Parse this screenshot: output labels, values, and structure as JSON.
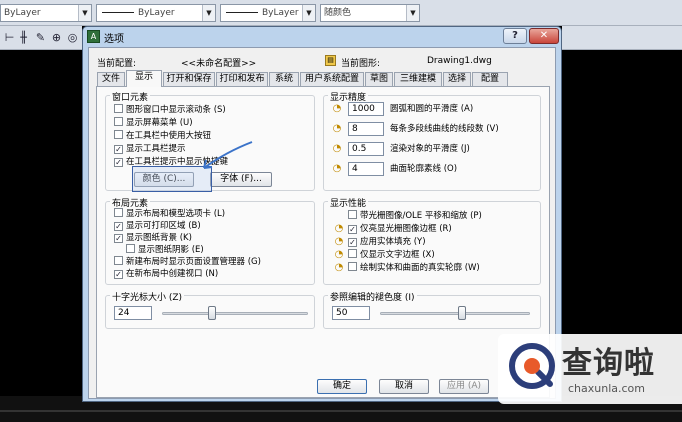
{
  "cad": {
    "layer_combo": "ByLayer",
    "linetype_combo": "ByLayer",
    "lineweight_combo": "ByLayer",
    "color_combo": "随颜色"
  },
  "dialog": {
    "title": "选项",
    "help": "?",
    "close": "✕",
    "current_config_label": "当前配置:",
    "current_config_value": "<<未命名配置>>",
    "current_drawing_label": "当前图形:",
    "current_drawing_value": "Drawing1.dwg",
    "tabs": [
      "文件",
      "显示",
      "打开和保存",
      "打印和发布",
      "系统",
      "用户系统配置",
      "草图",
      "三维建模",
      "选择",
      "配置"
    ],
    "active_tab": 1
  },
  "window_elements": {
    "title": "窗口元素",
    "items": [
      {
        "label": "图形窗口中显示滚动条 (S)",
        "checked": false
      },
      {
        "label": "显示屏幕菜单 (U)",
        "checked": false
      },
      {
        "label": "在工具栏中使用大按钮",
        "checked": false
      },
      {
        "label": "显示工具栏提示",
        "checked": true
      },
      {
        "label": "在工具栏提示中显示快捷键",
        "checked": true
      }
    ],
    "color_button": "颜色 (C)...",
    "font_button": "字体 (F)..."
  },
  "layout_elements": {
    "title": "布局元素",
    "items": [
      {
        "label": "显示布局和模型选项卡 (L)",
        "checked": false
      },
      {
        "label": "显示可打印区域 (B)",
        "checked": true
      },
      {
        "label": "显示图纸背景 (K)",
        "checked": true
      },
      {
        "label": "显示图纸阴影 (E)",
        "checked": false
      },
      {
        "label": "新建布局时显示页面设置管理器 (G)",
        "checked": false
      },
      {
        "label": "在新布局中创建视口 (N)",
        "checked": true
      }
    ]
  },
  "crosshair": {
    "title": "十字光标大小 (Z)",
    "value": "24",
    "fraction": 0.33
  },
  "display_resolution": {
    "title": "显示精度",
    "items": [
      {
        "value": "1000",
        "label": "圆弧和圆的平滑度 (A)"
      },
      {
        "value": "8",
        "label": "每条多段线曲线的线段数 (V)"
      },
      {
        "value": "0.5",
        "label": "渲染对象的平滑度 (J)"
      },
      {
        "value": "4",
        "label": "曲面轮廓素线 (O)"
      }
    ]
  },
  "display_performance": {
    "title": "显示性能",
    "items": [
      {
        "label": "带光栅图像/OLE 平移和缩放 (P)",
        "checked": false
      },
      {
        "label": "仅亮显光栅图像边框 (R)",
        "checked": true
      },
      {
        "label": "应用实体填充 (Y)",
        "checked": true
      },
      {
        "label": "仅显示文字边框 (X)",
        "checked": false
      },
      {
        "label": "绘制实体和曲面的真实轮廓 (W)",
        "checked": false
      }
    ]
  },
  "xref_fade": {
    "title": "参照编辑的褪色度 (I)",
    "value": "50",
    "fraction": 0.55
  },
  "footer": {
    "ok": "确定",
    "cancel": "取消",
    "apply": "应用 (A)"
  },
  "watermark": {
    "cn": "查询啦",
    "en": "chaxunla.com"
  }
}
